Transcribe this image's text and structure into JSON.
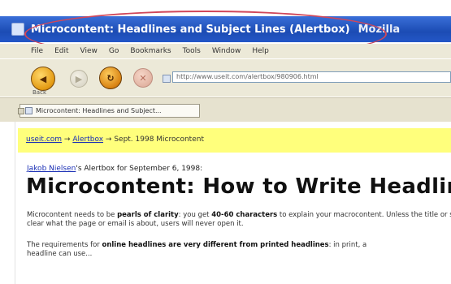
{
  "window": {
    "title": "Microcontent: Headlines and Subject Lines (Alertbox)",
    "app_name": "Mozilla"
  },
  "menu": [
    {
      "label": "File"
    },
    {
      "label": "Edit"
    },
    {
      "label": "View"
    },
    {
      "label": "Go"
    },
    {
      "label": "Bookmarks"
    },
    {
      "label": "Tools"
    },
    {
      "label": "Window"
    },
    {
      "label": "Help"
    }
  ],
  "toolbar": {
    "back_label": "Back",
    "forward_icon": "forward-arrow-icon",
    "reload_icon": "reload-icon",
    "stop_icon": "stop-icon",
    "url": "http://www.useit.com/alertbox/980906.html"
  },
  "tabs": [
    {
      "label": "Microcontent: Headlines and Subject..."
    }
  ],
  "breadcrumb": {
    "home": "useit.com",
    "section": "Alertbox",
    "current": "Sept. 1998 Microcontent"
  },
  "byline": {
    "author": "Jakob Nielsen",
    "rest": "'s Alertbox for September 6, 1998:"
  },
  "page": {
    "title": "Microcontent: How to Write Headlines",
    "para1_line1_a": "Microcontent needs to be ",
    "para1_line1_b": "pearls of clarity",
    "para1_line1_c": ": you get ",
    "para1_line1_d": "40-60 characters",
    "para1_line1_e": " to explain your macrocontent. Unless the title or subject line makes it",
    "para1_line2": "clear what the page or email is about, users will never open it.",
    "para2_line1_a": "The requirements for ",
    "para2_line1_b": "online headlines are very different from printed headlines",
    "para2_line1_c": ": in print, a",
    "para2_line2": "headline can use..."
  },
  "colors": {
    "titlebar": "#1c4cb4",
    "highlight_oval": "#d0475a",
    "breadcrumb_bg": "#ffff7c",
    "link": "#1a2fb5"
  }
}
